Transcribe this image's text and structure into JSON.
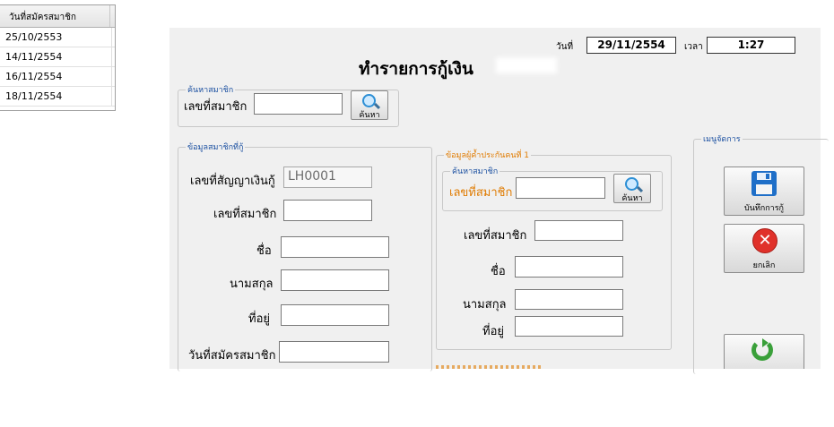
{
  "background_grid": {
    "header": "วันที่สมัครสมาชิก",
    "rows": [
      "25/10/2553",
      "14/11/2554",
      "16/11/2554",
      "18/11/2554"
    ]
  },
  "header": {
    "title": "ทำรายการกู้เงิน",
    "date_label": "วันที่",
    "date_value": "29/11/2554",
    "time_label": "เวลา",
    "time_value": "1:27"
  },
  "search_group": {
    "legend": "ค้นหาสมาชิก",
    "member_label": "เลขที่สมาชิก",
    "member_value": "",
    "button_label": "ค้นหา"
  },
  "borrower_group": {
    "legend": "ข้อมูลสมาชิกที่กู้",
    "contract_label": "เลขที่สัญญาเงินกู้",
    "contract_value": "LH0001",
    "member_label": "เลขที่สมาชิก",
    "first_name_label": "ชื่อ",
    "last_name_label": "นามสกุล",
    "address_label": "ที่อยู่",
    "join_date_label": "วันที่สมัครสมาชิก"
  },
  "guarantor_group": {
    "legend": "ข้อมูลผู้ค้ำประกันคนที่ 1",
    "search_legend": "ค้นหาสมาชิก",
    "search_label": "เลขที่สมาชิก",
    "search_button": "ค้นหา",
    "member_label": "เลขที่สมาชิก",
    "first_name_label": "ชื่อ",
    "last_name_label": "นามสกุล",
    "address_label": "ที่อยู่"
  },
  "menu_group": {
    "legend": "เมนูจัดการ",
    "save_label": "บันทึกการกู้",
    "cancel_label": "ยกเลิก"
  },
  "colors": {
    "accent_blue": "#1a4fa0",
    "accent_orange": "#e07b00",
    "form_bg": "#f0f0f0"
  }
}
